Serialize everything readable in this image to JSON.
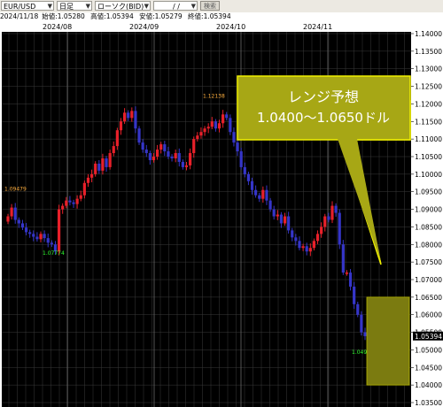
{
  "toolbar": {
    "symbol": "EUR/USD",
    "period": "日足",
    "chart_kind": "ローソク(BID)",
    "date_input": "/ /",
    "search_label": "検索"
  },
  "info": {
    "date": "2024/11/18",
    "open_label": "始値:",
    "open": "1.05280",
    "high_label": "高値:",
    "high": "1.05394",
    "low_label": "安値:",
    "low": "1.05279",
    "close_label": "終値:",
    "close": "1.05394"
  },
  "chart_data": {
    "type": "candlestick",
    "x_ticks": [
      "2024/08",
      "2024/09",
      "2024/10",
      "2024/11"
    ],
    "ylim": [
      1.035,
      1.14
    ],
    "y_ticks": [
      "1.14000",
      "1.13500",
      "1.13000",
      "1.12500",
      "1.12000",
      "1.11500",
      "1.11000",
      "1.10500",
      "1.10000",
      "1.09500",
      "1.09000",
      "1.08500",
      "1.08000",
      "1.07500",
      "1.07000",
      "1.06500",
      "1.06000",
      "1.05500",
      "1.05000",
      "1.04500",
      "1.04000",
      "1.03500"
    ],
    "current_price": "1.05394",
    "up_color": "#e8202a",
    "down_color": "#3535c8",
    "background": "#000000",
    "grid": true,
    "closes": [
      1.088,
      1.0905,
      1.087,
      1.086,
      1.0848,
      1.0835,
      1.083,
      1.0822,
      1.0815,
      1.083,
      1.0818,
      1.0805,
      1.08,
      1.078,
      1.09,
      1.091,
      1.0925,
      1.092,
      1.0915,
      1.093,
      1.094,
      1.0975,
      1.099,
      1.1,
      1.103,
      1.101,
      1.1045,
      1.102,
      1.106,
      1.108,
      1.1125,
      1.115,
      1.1175,
      1.116,
      1.118,
      1.113,
      1.109,
      1.107,
      1.106,
      1.104,
      1.105,
      1.107,
      1.1085,
      1.1065,
      1.105,
      1.1045,
      1.106,
      1.1035,
      1.102,
      1.1025,
      1.106,
      1.11,
      1.111,
      1.112,
      1.113,
      1.1135,
      1.115,
      1.113,
      1.1145,
      1.117,
      1.116,
      1.112,
      1.109,
      1.1065,
      1.102,
      1.1,
      1.098,
      1.0955,
      1.094,
      1.093,
      1.0955,
      1.0925,
      1.09,
      1.088,
      1.0885,
      1.086,
      1.088,
      1.084,
      1.082,
      1.081,
      1.079,
      1.0795,
      1.078,
      1.079,
      1.081,
      1.083,
      1.085,
      1.088,
      1.087,
      1.091,
      1.089,
      1.08,
      1.072,
      1.072,
      1.068,
      1.063,
      1.06,
      1.055,
      1.0539
    ],
    "annotations": [
      {
        "text": "1.09479",
        "color": "#ffb040"
      },
      {
        "text": "1.07774",
        "color": "#30ff30"
      },
      {
        "text": "1.12138",
        "color": "#ffb040"
      },
      {
        "text": "1.04955",
        "color": "#30ff30"
      }
    ],
    "forecast": {
      "title": "レンジ予想",
      "range_text": "1.0400〜1.0650ドル",
      "low": 1.04,
      "high": 1.065,
      "fill": "#7b7b10",
      "callout_fill": "#a7a715",
      "callout_border": "#f0f000"
    }
  }
}
